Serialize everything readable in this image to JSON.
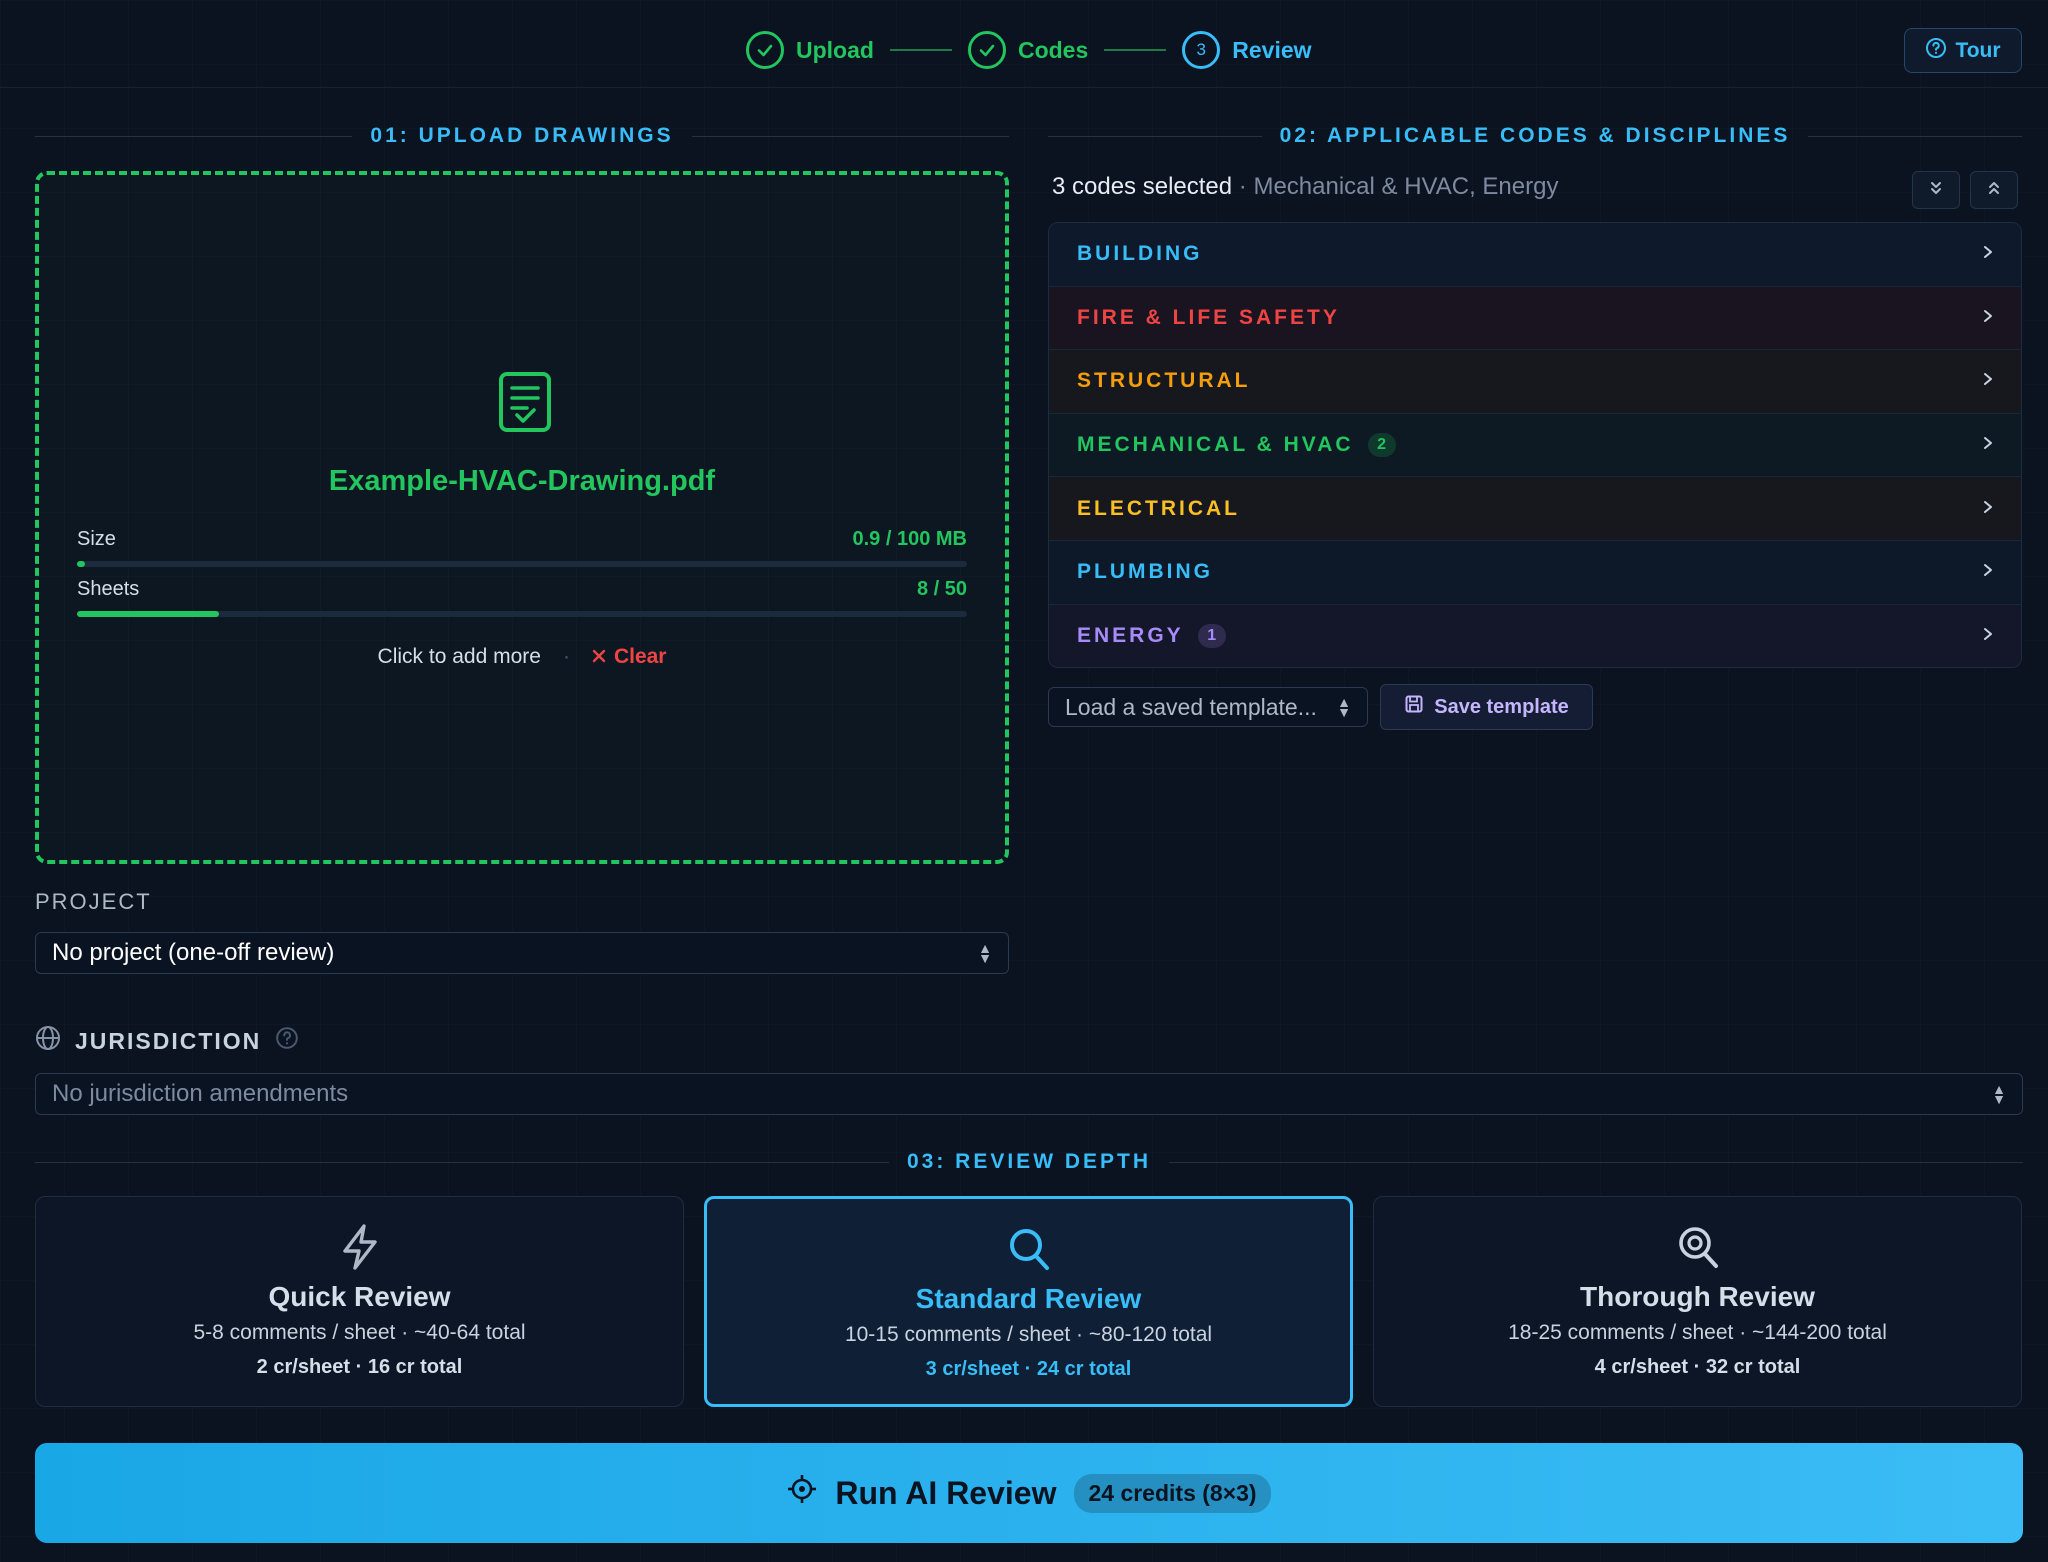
{
  "stepper": {
    "steps": [
      {
        "label": "Upload",
        "state": "done"
      },
      {
        "label": "Codes",
        "state": "done"
      },
      {
        "label": "Review",
        "number": "3",
        "state": "active"
      }
    ],
    "tour_label": "Tour"
  },
  "upload": {
    "heading": "01: UPLOAD DRAWINGS",
    "file_name": "Example-HVAC-Drawing.pdf",
    "size_label": "Size",
    "size_value": "0.9 / 100 MB",
    "size_fraction": 0.009,
    "sheets_label": "Sheets",
    "sheets_value": "8 / 50",
    "sheets_fraction": 0.16,
    "add_more": "Click to add more",
    "clear": "Clear"
  },
  "project": {
    "label": "PROJECT",
    "value": "No project (one-off review)"
  },
  "jurisdiction": {
    "label": "JURISDICTION",
    "value": "No jurisdiction amendments"
  },
  "codes": {
    "heading": "02: APPLICABLE CODES & DISCIPLINES",
    "summary_count": "3 codes selected",
    "summary_detail": " · Mechanical & HVAC, Energy",
    "categories": [
      {
        "label": "BUILDING",
        "color": "#38bdf8",
        "bg": "#0e1a2c",
        "badge": ""
      },
      {
        "label": "FIRE & LIFE SAFETY",
        "color": "#ef4444",
        "bg": "#1a1420",
        "badge": ""
      },
      {
        "label": "STRUCTURAL",
        "color": "#f59e0b",
        "bg": "#17171e",
        "badge": ""
      },
      {
        "label": "MECHANICAL & HVAC",
        "color": "#22c55e",
        "bg": "#0d1a24",
        "badge": "2"
      },
      {
        "label": "ELECTRICAL",
        "color": "#fbbf24",
        "bg": "#17181e",
        "badge": ""
      },
      {
        "label": "PLUMBING",
        "color": "#38bdf8",
        "bg": "#0d1828",
        "badge": ""
      },
      {
        "label": "ENERGY",
        "color": "#a78bfa",
        "bg": "#141629",
        "badge": "1"
      }
    ],
    "template_placeholder": "Load a saved template...",
    "save_template": "Save template"
  },
  "depth": {
    "heading": "03: REVIEW DEPTH",
    "options": [
      {
        "title": "Quick Review",
        "desc": "5-8 comments / sheet · ~40-64 total",
        "cost": "2 cr/sheet · 16 cr total",
        "icon": "lightning-icon",
        "selected": false
      },
      {
        "title": "Standard Review",
        "desc": "10-15 comments / sheet · ~80-120 total",
        "cost": "3 cr/sheet · 24 cr total",
        "icon": "search-icon",
        "selected": true
      },
      {
        "title": "Thorough Review",
        "desc": "18-25 comments / sheet · ~144-200 total",
        "cost": "4 cr/sheet · 32 cr total",
        "icon": "zoom-search-icon",
        "selected": false
      }
    ]
  },
  "run": {
    "label": "Run AI Review",
    "credits": "24 credits (8×3)"
  },
  "colors": {
    "accent": "#38bdf8",
    "success": "#22c55e",
    "danger": "#ef4444",
    "background": "#0b1220"
  }
}
